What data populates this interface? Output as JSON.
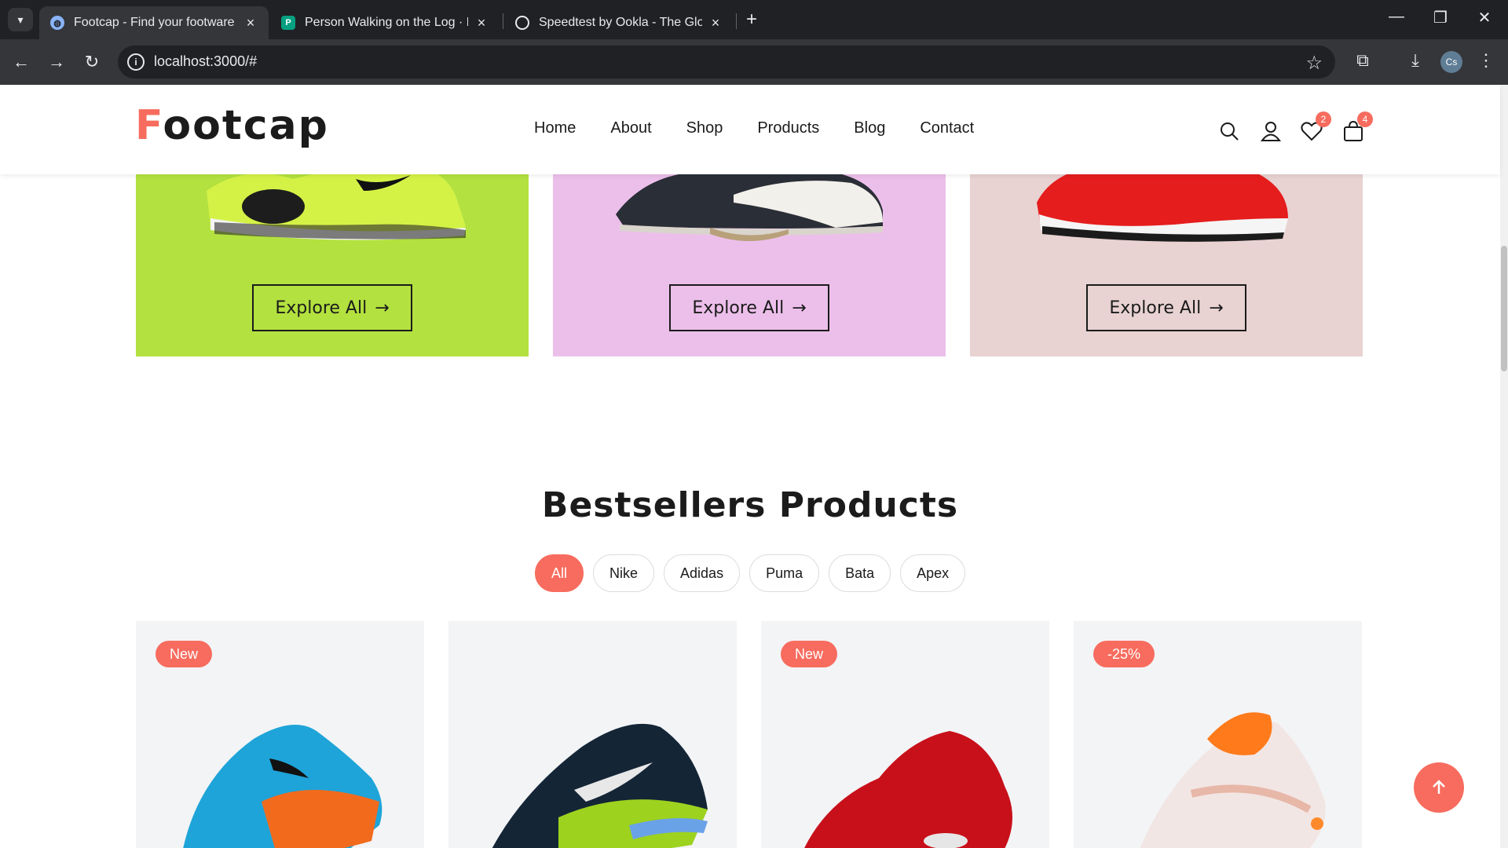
{
  "browser": {
    "tabs": [
      {
        "title": "Footcap - Find your footware",
        "active": true
      },
      {
        "title": "Person Walking on the Log · Fre",
        "active": false
      },
      {
        "title": "Speedtest by Ookla - The Globa",
        "active": false
      }
    ],
    "url": "localhost:3000/#",
    "profile_initials": "Cs"
  },
  "header": {
    "logo_first": "F",
    "logo_rest": "ootcap",
    "menu": [
      "Home",
      "About",
      "Shop",
      "Products",
      "Blog",
      "Contact"
    ],
    "wishlist_count": "2",
    "cart_count": "4"
  },
  "categories": [
    {
      "button": "Explore All",
      "color": "#b3e13f"
    },
    {
      "button": "Explore All",
      "color": "#ecbfea"
    },
    {
      "button": "Explore All",
      "color": "#e8d2d2"
    }
  ],
  "bestsellers": {
    "title": "Bestsellers Products",
    "filters": [
      "All",
      "Nike",
      "Adidas",
      "Puma",
      "Bata",
      "Apex"
    ],
    "active_filter": "All",
    "products": [
      {
        "tag": "New"
      },
      {
        "tag": ""
      },
      {
        "tag": "New"
      },
      {
        "tag": "-25%"
      }
    ]
  },
  "colors": {
    "accent": "#f76c5e",
    "text": "#1b1b1b"
  }
}
